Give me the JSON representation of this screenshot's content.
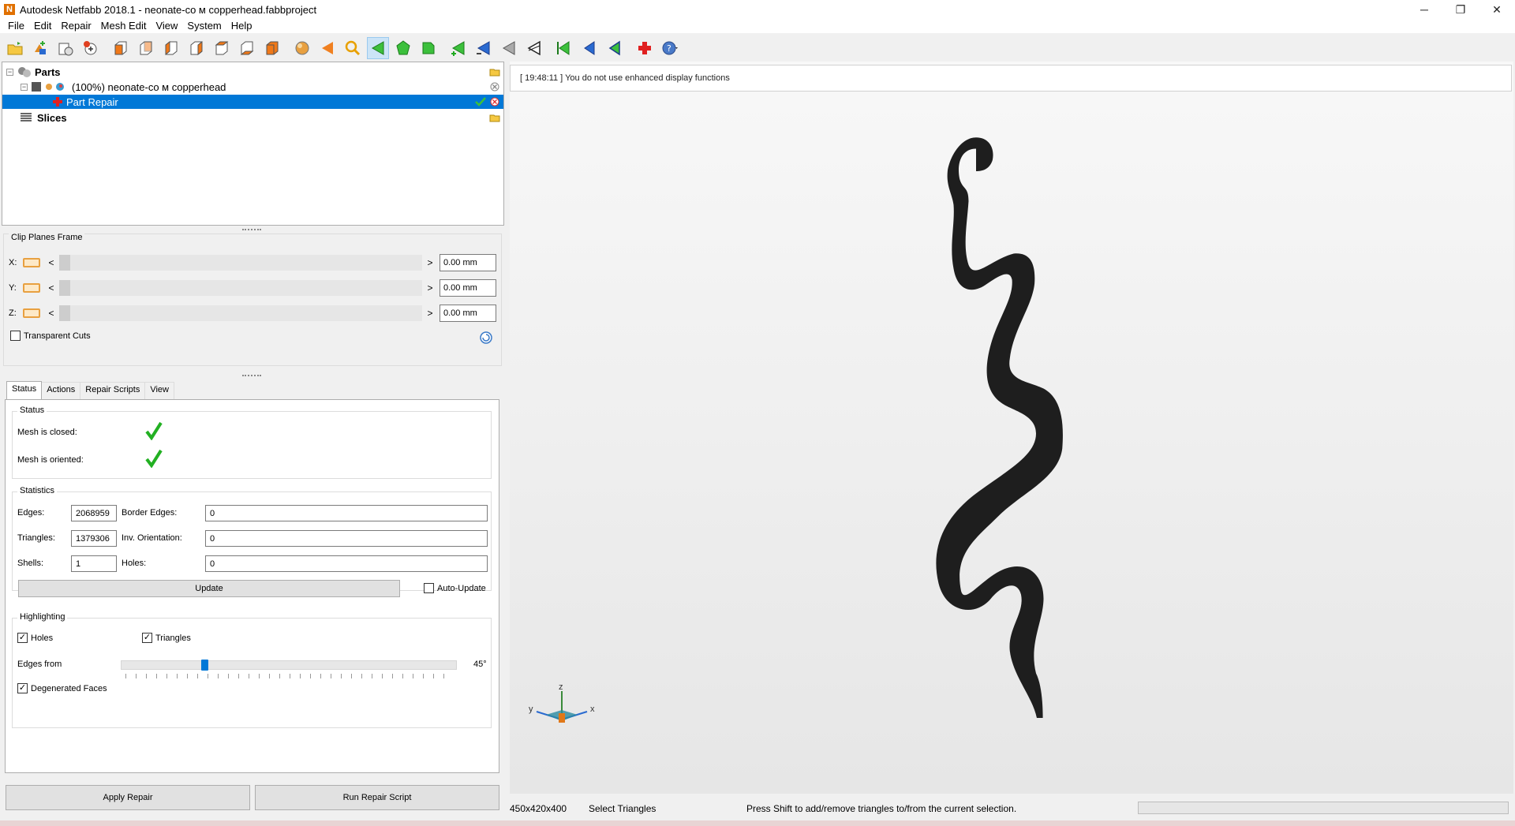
{
  "window": {
    "title": "Autodesk Netfabb 2018.1 - neonate-co м copperhead.fabbproject",
    "app_icon": "N",
    "minimize": "─",
    "restore": "❐",
    "close": "✕"
  },
  "menu": [
    "File",
    "Edit",
    "Repair",
    "Mesh Edit",
    "View",
    "System",
    "Help"
  ],
  "toolbar": {
    "icons": [
      "open-project-icon",
      "add-part-icon",
      "new-part-icon",
      "add-slice-icon",
      "view-front-icon",
      "view-back-icon",
      "view-left-icon",
      "view-right-icon",
      "view-top-icon",
      "view-bottom-icon",
      "view-iso-icon",
      "shading-icon",
      "arrow-left-icon",
      "zoom-icon",
      "select-triangles-icon",
      "select-surfaces-icon",
      "select-shells-icon",
      "triangle-add-icon",
      "triangle-remove-icon",
      "triangle-invert-icon",
      "triangle-delete-icon",
      "mark-green-icon",
      "mark-blue-icon",
      "mark-outline-icon",
      "repair-cross-icon",
      "help-icon"
    ],
    "active_index": 14
  },
  "tree": {
    "parts_label": "Parts",
    "part_label": "(100%) neonate-co м copperhead",
    "repair_label": "Part Repair",
    "slices_label": "Slices"
  },
  "clip_planes": {
    "title": "Clip Planes Frame",
    "rows": [
      {
        "axis": "X:",
        "value": "0.00 mm"
      },
      {
        "axis": "Y:",
        "value": "0.00 mm"
      },
      {
        "axis": "Z:",
        "value": "0.00 mm"
      }
    ],
    "left_arrow": "<",
    "right_arrow": ">",
    "transparent_cuts": "Transparent Cuts"
  },
  "tabs": [
    "Status",
    "Actions",
    "Repair Scripts",
    "View"
  ],
  "status_group": {
    "title": "Status",
    "mesh_closed": "Mesh is closed:",
    "mesh_oriented": "Mesh is oriented:"
  },
  "statistics": {
    "title": "Statistics",
    "edges_label": "Edges:",
    "edges": "2068959",
    "border_edges_label": "Border Edges:",
    "border_edges": "0",
    "triangles_label": "Triangles:",
    "triangles": "1379306",
    "inv_orientation_label": "Inv. Orientation:",
    "inv_orientation": "0",
    "shells_label": "Shells:",
    "shells": "1",
    "holes_label": "Holes:",
    "holes": "0",
    "update_button": "Update",
    "auto_update": "Auto-Update"
  },
  "highlighting": {
    "title": "Highlighting",
    "holes": "Holes",
    "triangles": "Triangles",
    "edges_from": "Edges from",
    "edges_from_value": "45°",
    "edges_from_fraction": 0.25,
    "degenerated_faces": "Degenerated Faces"
  },
  "buttons": {
    "apply_repair": "Apply Repair",
    "run_repair_script": "Run Repair Script"
  },
  "viewport": {
    "message": "[ 19:48:11 ] You do not use enhanced display functions",
    "axis_x": "x",
    "axis_y": "y",
    "axis_z": "z"
  },
  "statusbar": {
    "dimensions": "450x420x400",
    "mode": "Select Triangles",
    "hint": "Press Shift to add/remove triangles to/from the current selection."
  }
}
